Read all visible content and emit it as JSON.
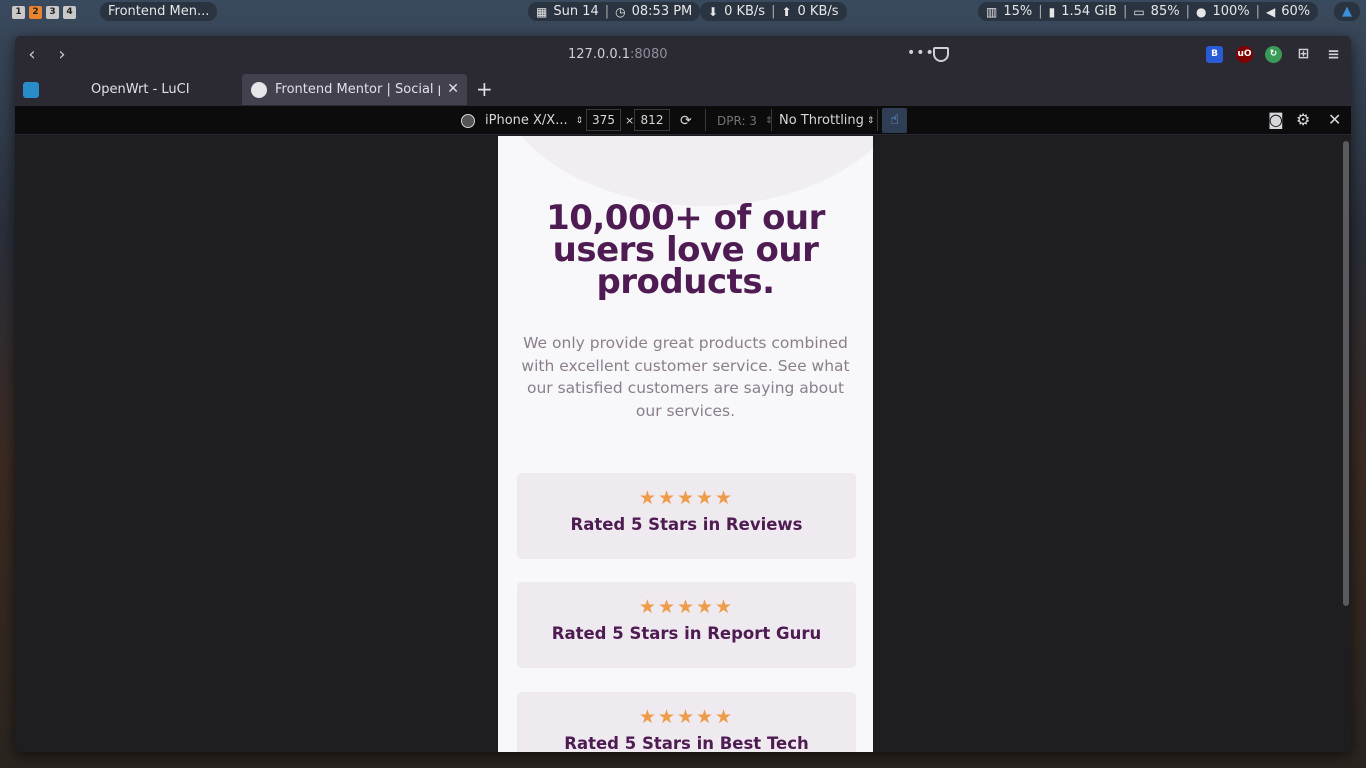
{
  "system": {
    "workspaces": [
      "1",
      "2",
      "3",
      "4"
    ],
    "active_workspace": "2",
    "window_title": "Frontend Men...",
    "date": "Sun 14",
    "time": "08:53 PM",
    "net_down": "0 KB/s",
    "net_up": "0 KB/s",
    "cpu": "15%",
    "memory": "1.54 GiB",
    "battery": "85%",
    "brightness": "100%",
    "volume": "60%"
  },
  "browser": {
    "url_host": "127.0.0.1",
    "url_port": ":8080",
    "tabs": [
      {
        "label": "OpenWrt - LuCI"
      },
      {
        "label": "Frontend Mentor | Social pr"
      }
    ]
  },
  "rdm": {
    "device": "iPhone X/X...",
    "width": "375",
    "height": "812",
    "times": "×",
    "dpr": "DPR: 3",
    "throttling": "No Throttling"
  },
  "page": {
    "title": "10,000+ of our users love our products.",
    "description": "We only provide great products combined with excellent customer service. See what our satisfied customers are saying about our services.",
    "stars": "★★★★★",
    "ratings": [
      "Rated 5 Stars in Reviews",
      "Rated 5 Stars in Report Guru",
      "Rated 5 Stars in Best Tech"
    ]
  },
  "colors": {
    "heading": "#4e1c52",
    "star": "#ee9c4a",
    "card_bg": "#eeeaef",
    "body_text": "#8b7f8c"
  }
}
